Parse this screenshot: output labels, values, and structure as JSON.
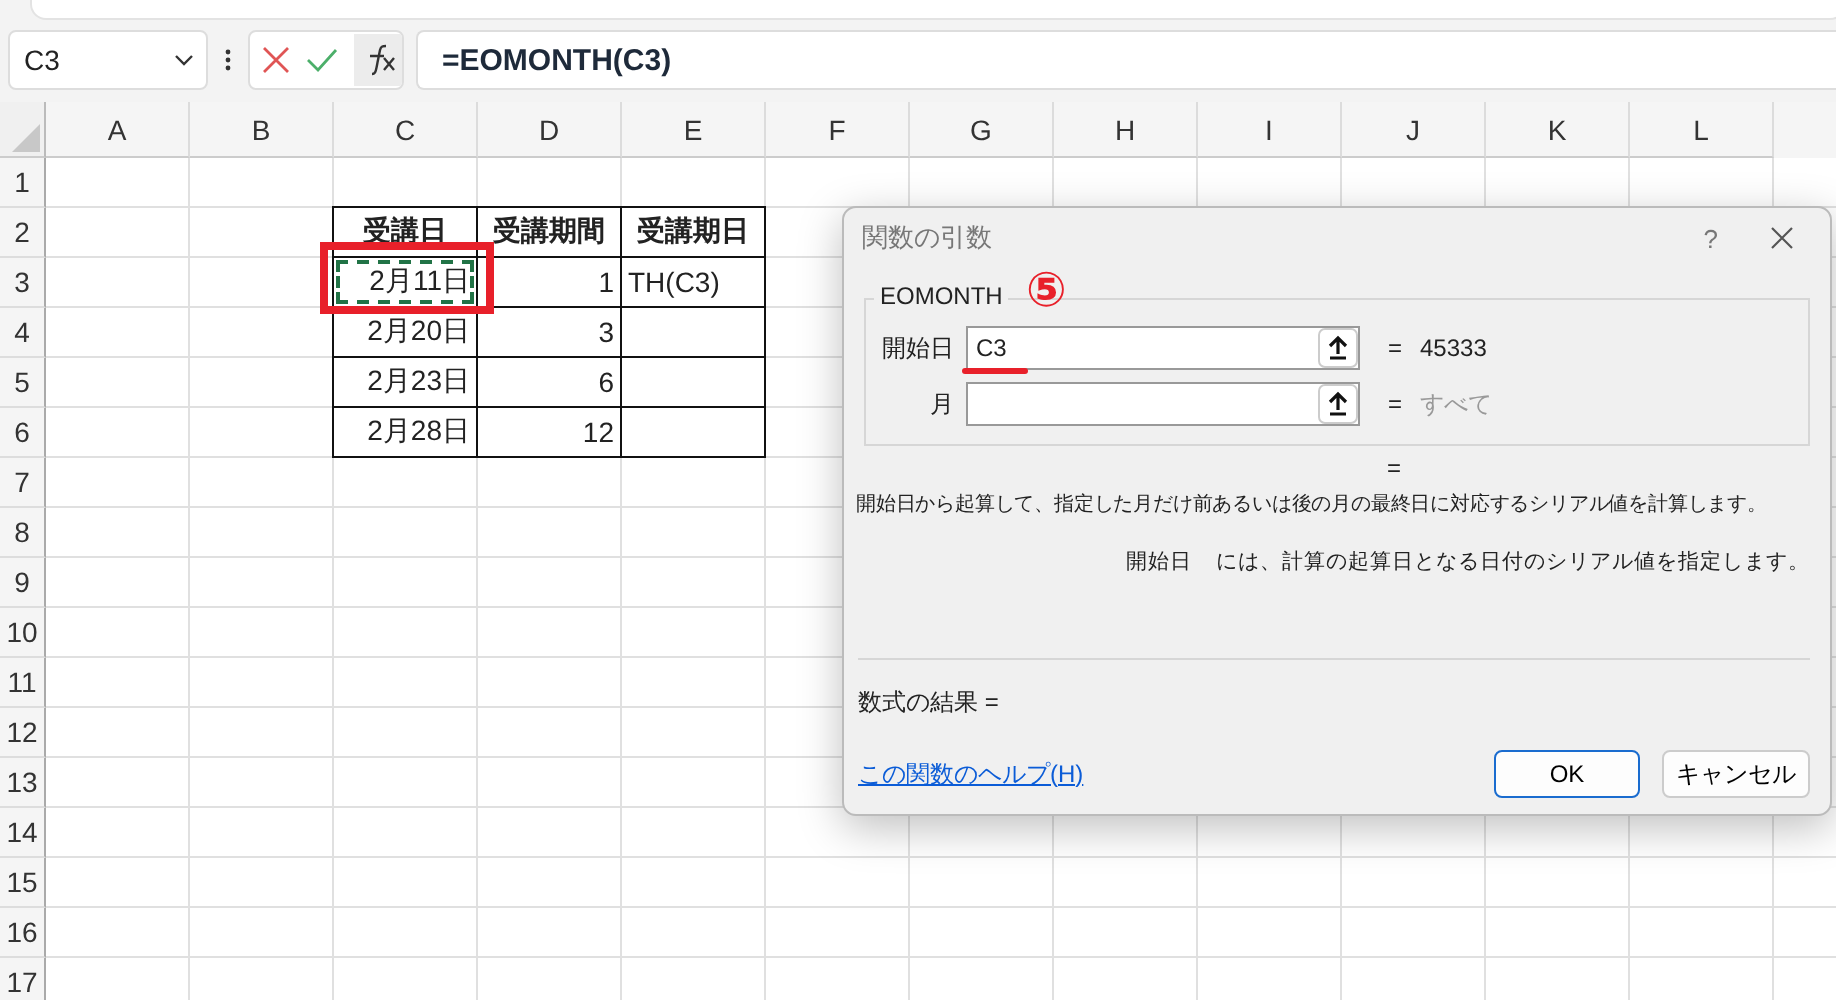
{
  "formula_bar": {
    "name_box": "C3",
    "formula": "=EOMONTH(C3)"
  },
  "sheet": {
    "columns": [
      "A",
      "B",
      "C",
      "D",
      "E",
      "F",
      "G",
      "H",
      "I",
      "J",
      "K",
      "L"
    ],
    "row_headers": [
      "1",
      "2",
      "3",
      "4",
      "5",
      "6",
      "7",
      "8",
      "9",
      "10",
      "11",
      "12",
      "13",
      "14",
      "15",
      "16",
      "17"
    ],
    "table": {
      "headers": [
        "受講日",
        "受講期間",
        "受講期日"
      ],
      "rows": [
        [
          {
            "text": "2月11日",
            "selected": true
          },
          {
            "text": "1",
            "selected": false
          },
          {
            "text": "TH(C3)",
            "selected": false
          }
        ],
        [
          {
            "text": "2月20日",
            "selected": false
          },
          {
            "text": "3",
            "selected": false
          }
        ],
        [
          {
            "text": "2月23日",
            "selected": false
          },
          {
            "text": "6",
            "selected": false
          }
        ],
        [
          {
            "text": "2月28日",
            "selected": false
          },
          {
            "text": "12",
            "selected": false
          }
        ]
      ]
    }
  },
  "dialog": {
    "title": "関数の引数",
    "help": "?",
    "function_name": "EOMONTH",
    "step_marker": "⑤",
    "arguments": [
      {
        "label": "開始日",
        "value": "C3",
        "equals": "=",
        "result": "45333",
        "muted": false
      },
      {
        "label": "月",
        "equals": "=",
        "result": "すべて",
        "muted": true
      }
    ],
    "value_equals": "=",
    "description": "開始日から起算して、指定した月だけ前あるいは後の月の最終日に対応するシリアル値を計算します。",
    "argument_name": "開始日",
    "argument_description": "には、計算の起算日となる日付のシリアル値を指定します。",
    "formula_result": "数式の結果 =",
    "help_link": "この関数のヘルプ(H)",
    "buttons": [
      {
        "label": "OK",
        "default": true
      },
      {
        "label": "キャンセル",
        "default": false
      }
    ]
  }
}
